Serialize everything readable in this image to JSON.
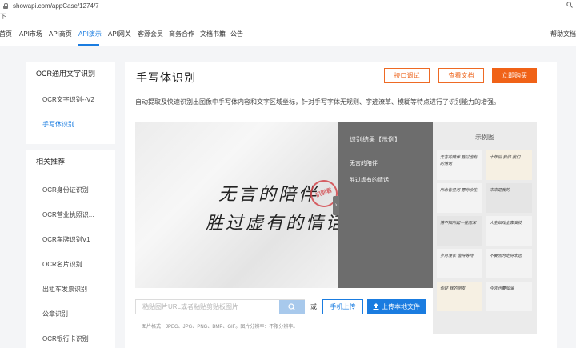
{
  "browser": {
    "url": "showapi.com/appCase/1274/7"
  },
  "bookmark_bar": {
    "label": "下"
  },
  "nav": {
    "items": [
      "首页",
      "API市场",
      "API商页",
      "API演示",
      "API网关",
      "客源会员",
      "商务合作",
      "文档书籍",
      "公告"
    ],
    "right": "帮助文档",
    "active_index": 3
  },
  "sidebar": {
    "section1": {
      "title": "OCR通用文字识别",
      "items": [
        "OCR文字识别--V2",
        "手写体识别"
      ],
      "active_index": 1
    },
    "section2": {
      "title": "相关推荐",
      "items": [
        "OCR身份证识别",
        "OCR营业执照识...",
        "OCR车牌识别V1",
        "OCR名片识别",
        "出租车发票识别",
        "公章识别",
        "OCR银行卡识别"
      ]
    }
  },
  "main": {
    "title": "手写体识别",
    "buttons": {
      "debug": "接口调试",
      "docs": "查看文档",
      "buy": "立即购买"
    },
    "description": "自动提取及快速识别出图像中手写体内容和文字区域坐标，针对手写字体无规则、字迹潦草、模糊等特点进行了识别能力的增强。",
    "demo": {
      "handwriting_line1": "无言的陪伴",
      "handwriting_line2": "胜过虚有的情话",
      "seal_text": "识别君",
      "result_head": "识别结果【示例】",
      "result_lines": [
        "无言的陪伴",
        "胜过虚有的情话"
      ]
    },
    "examples": {
      "label": "示例图",
      "thumbs": [
        "无言的陪伴 胜过虚有的情话",
        "十年后 我们 我们",
        "所念皆星河 愿你余生",
        "未来是我的",
        "情不知所起一往而深",
        "人生如戏全靠演技",
        "岁月漫长 值得等待",
        "不要因为走得太远",
        "你好 我的朋友",
        "今天也要加油"
      ]
    },
    "upload": {
      "placeholder": "粘贴图片URL或者粘贴剪贴板图片",
      "or": "或",
      "mobile": "手机上传",
      "local": "上传本地文件",
      "formats": "图片格式：JPEG、JPG、PNG、BMP、GIF。图片分辨率：不限分辨率。"
    }
  },
  "colors": {
    "accent_blue": "#1a7ce0",
    "accent_orange": "#f06217"
  }
}
